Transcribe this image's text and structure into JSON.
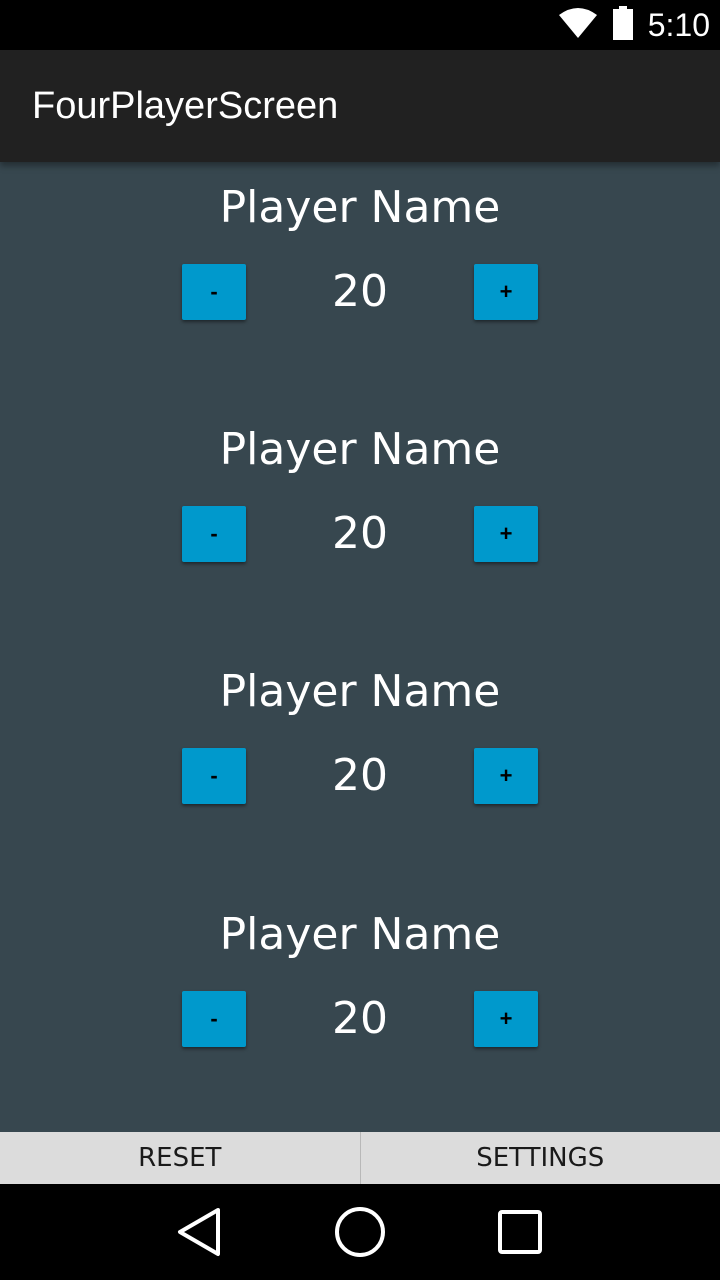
{
  "status_bar": {
    "time": "5:10",
    "icons": [
      "wifi-icon",
      "battery-icon"
    ]
  },
  "app_bar": {
    "title": "FourPlayerScreen"
  },
  "players": [
    {
      "name": "Player Name",
      "life": "20",
      "minus_label": "-",
      "plus_label": "+"
    },
    {
      "name": "Player Name",
      "life": "20",
      "minus_label": "-",
      "plus_label": "+"
    },
    {
      "name": "Player Name",
      "life": "20",
      "minus_label": "-",
      "plus_label": "+"
    },
    {
      "name": "Player Name",
      "life": "20",
      "minus_label": "-",
      "plus_label": "+"
    }
  ],
  "bottom_bar": {
    "reset_label": "RESET",
    "settings_label": "SETTINGS"
  },
  "nav_bar": {
    "icons": [
      "back-icon",
      "home-icon",
      "recents-icon"
    ]
  },
  "colors": {
    "background": "#37474f",
    "app_bar": "#212121",
    "button": "#0099cc",
    "bottom_bar": "#dcdcdc"
  }
}
